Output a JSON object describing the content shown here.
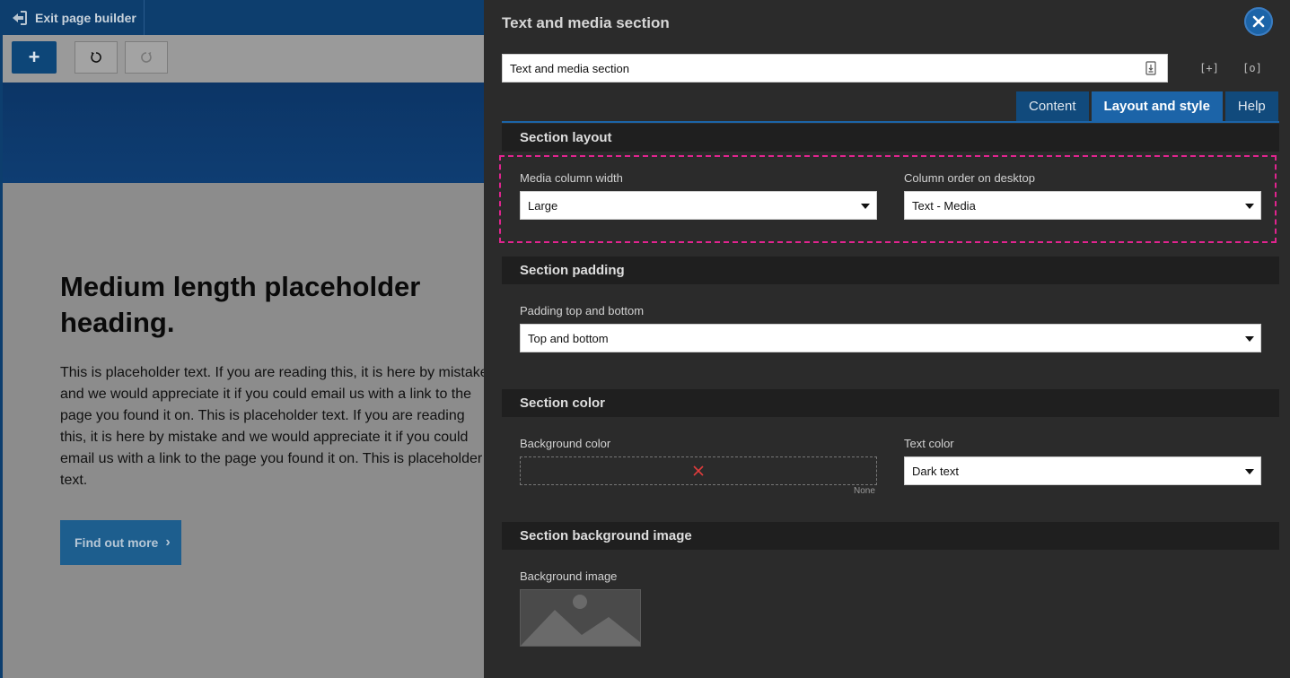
{
  "builder": {
    "exit_label": "Exit page builder",
    "add_label": "+",
    "page": {
      "heading": "Medium length placeholder heading.",
      "body_lines": [
        "This is placeholder text. If you are reading this, it is here by mistake",
        "and we would appreciate it if you could email us with a link to the",
        "page you found it on. This is placeholder text. If you are reading",
        "this, it is here by mistake and we would appreciate it if you could",
        "email us with a link to the page you found it on. This is placeholder",
        "text."
      ],
      "cta_label": "Find out more"
    }
  },
  "panel": {
    "title": "Text and media section",
    "name_value": "Text and media section",
    "tabs": [
      {
        "label": "Content",
        "active": false
      },
      {
        "label": "Layout and style",
        "active": true
      },
      {
        "label": "Help",
        "active": false
      }
    ],
    "sections": {
      "layout": {
        "header": "Section layout",
        "media_width_label": "Media column width",
        "media_width_value": "Large",
        "column_order_label": "Column order on desktop",
        "column_order_value": "Text - Media"
      },
      "padding": {
        "header": "Section padding",
        "padding_label": "Padding top and bottom",
        "padding_value": "Top and bottom"
      },
      "color": {
        "header": "Section color",
        "bg_label": "Background color",
        "bg_none": "None",
        "text_color_label": "Text color",
        "text_color_value": "Dark text"
      },
      "bg_image": {
        "header": "Section background image",
        "image_label": "Background image"
      }
    }
  },
  "colors": {
    "accent": "#1c64a8",
    "highlight": "#e0248e",
    "clear_x": "#e03c3c"
  },
  "icons": [
    "exit-icon",
    "undo-icon",
    "redo-icon",
    "close-icon",
    "field-info-icon",
    "expand-icon",
    "collapse-icon",
    "clear-color-icon",
    "image-placeholder-icon",
    "chevron-right-icon"
  ]
}
